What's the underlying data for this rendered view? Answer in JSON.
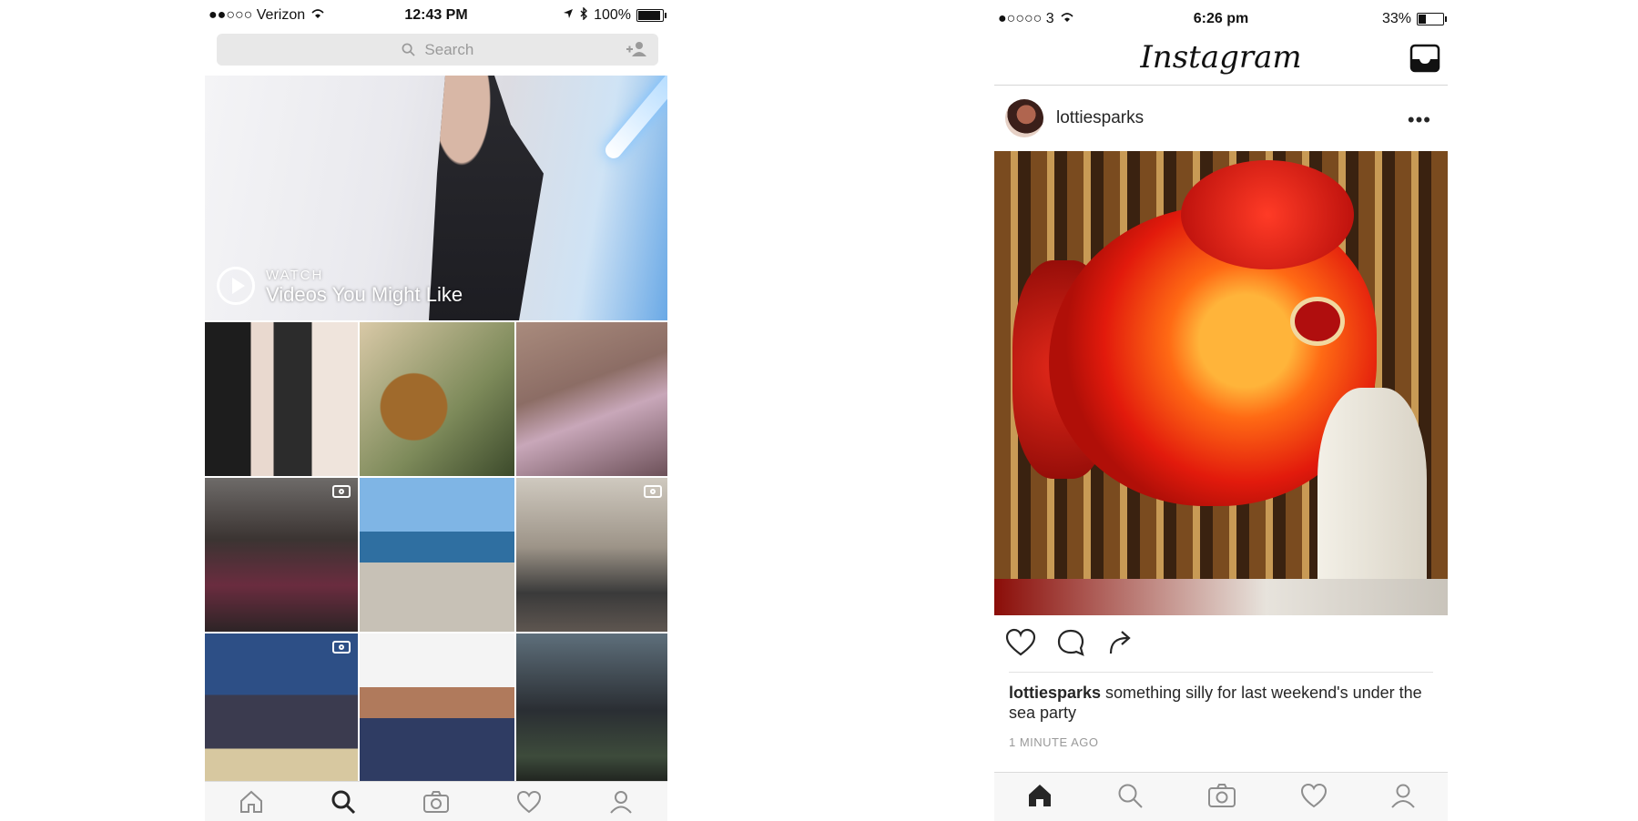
{
  "left_phone": {
    "status": {
      "carrier": "●●○○○ Verizon",
      "time": "12:43 PM",
      "battery": "100%"
    },
    "search": {
      "placeholder": "Search"
    },
    "video": {
      "kicker": "WATCH",
      "title": "Videos You Might Like"
    },
    "tabbar": [
      "home-icon",
      "search-icon",
      "camera-icon",
      "heart-icon",
      "profile-icon"
    ]
  },
  "right_phone": {
    "status": {
      "carrier": "●○○○○ 3",
      "time": "6:26 pm",
      "battery": "33%"
    },
    "header": {
      "logo": "Instagram"
    },
    "post": {
      "username": "lottiesparks",
      "more": "•••",
      "caption_user": "lottiesparks",
      "caption_text": "something silly for last weekend's under the sea party",
      "time_ago": "1 MINUTE AGO"
    },
    "tabbar": [
      "home-icon",
      "search-icon",
      "camera-icon",
      "heart-icon",
      "profile-icon"
    ]
  },
  "colors": {
    "ig_text": "#262626",
    "muted": "#999999",
    "bar_bg": "#f6f6f6"
  }
}
